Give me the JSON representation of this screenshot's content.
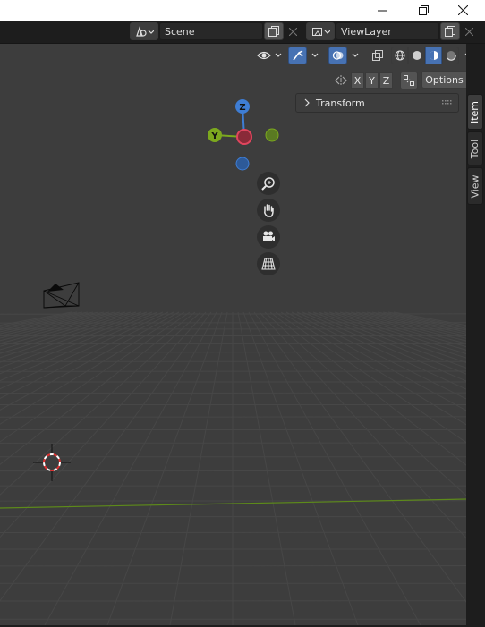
{
  "window": {
    "controls": [
      "minimize-icon",
      "restore-icon",
      "close-icon"
    ]
  },
  "header": {
    "scene_label": "Scene",
    "view_layer_label": "ViewLayer"
  },
  "viewport_header": {
    "axis_labels": [
      "X",
      "Y",
      "Z"
    ],
    "options_label": "Options",
    "shading_modes": [
      "wireframe",
      "solid",
      "material-preview",
      "rendered"
    ],
    "active_shading": "material-preview"
  },
  "gizmo": {
    "axes": [
      "Z",
      "Y"
    ]
  },
  "sidebar": {
    "tabs": [
      "Item",
      "Tool",
      "View"
    ],
    "active_tab": "Item",
    "panels": [
      {
        "label": "Transform",
        "expanded": false
      }
    ]
  },
  "colors": {
    "accent": "#4772b3",
    "x_axis": "#e0455d",
    "y_axis": "#7ca81e",
    "z_axis": "#3e7dd4",
    "floor_green_line": "#5d8a1a"
  }
}
